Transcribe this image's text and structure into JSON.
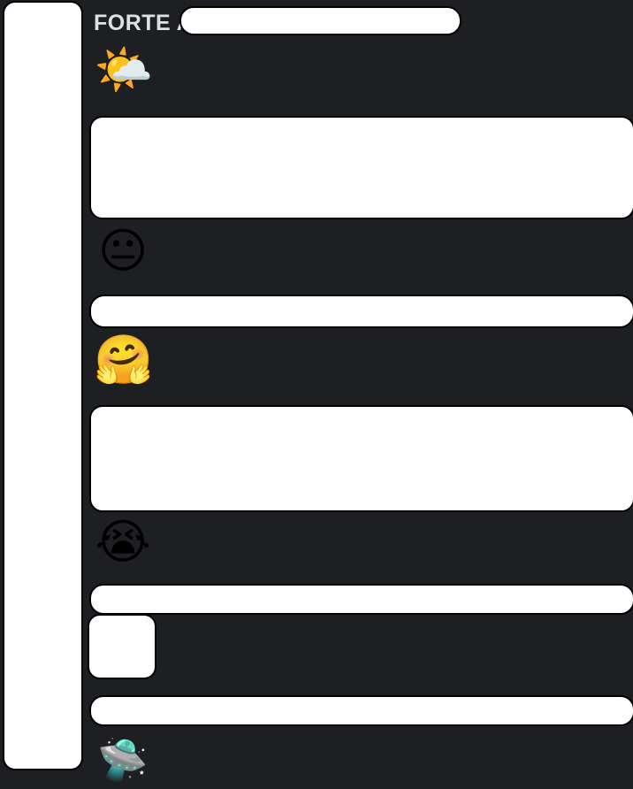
{
  "channel": {
    "title": "FORTE A"
  },
  "entries": [
    {
      "emoji": "🌤️",
      "icon_name": "sun-behind-cloud-icon"
    },
    {
      "emoji": "😐",
      "icon_name": "neutral-face-icon"
    },
    {
      "emoji": "🤗",
      "icon_name": "hugging-face-icon"
    },
    {
      "emoji": "😭",
      "icon_name": "loudly-crying-face-icon"
    },
    {
      "emoji": "🛸",
      "icon_name": "flying-saucer-icon"
    }
  ],
  "colors": {
    "background": "#1e1f22",
    "title": "#dfe0e2",
    "redaction_fill": "#ffffff",
    "redaction_border": "#000000"
  }
}
